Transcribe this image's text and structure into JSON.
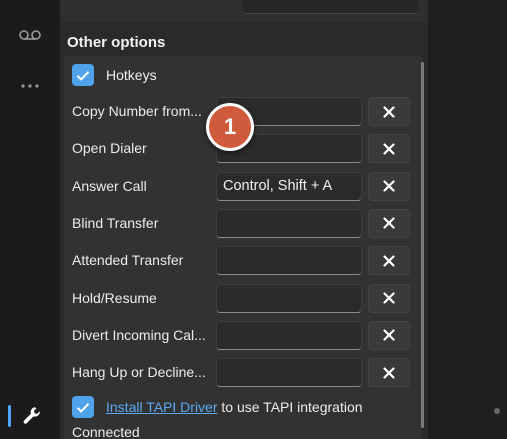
{
  "section_title": "Other options",
  "hotkeys": {
    "label": "Hotkeys",
    "checked": true,
    "rows": [
      {
        "label": "Copy Number from...",
        "value": "",
        "clear_icon": "close-icon"
      },
      {
        "label": "Open Dialer",
        "value": "",
        "clear_icon": "close-icon"
      },
      {
        "label": "Answer Call",
        "value": "Control, Shift + A",
        "clear_icon": "close-icon"
      },
      {
        "label": "Blind Transfer",
        "value": "",
        "clear_icon": "close-icon"
      },
      {
        "label": "Attended Transfer",
        "value": "",
        "clear_icon": "close-icon"
      },
      {
        "label": "Hold/Resume",
        "value": "",
        "clear_icon": "close-icon"
      },
      {
        "label": "Divert Incoming Cal...",
        "value": "",
        "clear_icon": "close-icon"
      },
      {
        "label": "Hang Up or Decline...",
        "value": "",
        "clear_icon": "close-icon"
      }
    ]
  },
  "tapi": {
    "checked": true,
    "link_text": "Install TAPI Driver",
    "suffix_text": "to use TAPI integration",
    "status": "Connected"
  },
  "marker": {
    "number": "1"
  },
  "nav": {
    "icons": [
      "voicemail-icon",
      "more-icon",
      "wrench-icon"
    ]
  },
  "colors": {
    "accent": "#4fa3ea",
    "link": "#5aa9f2",
    "marker": "#cf5a3c",
    "panel": "#2a2a2a",
    "background": "#1f1f1f"
  }
}
